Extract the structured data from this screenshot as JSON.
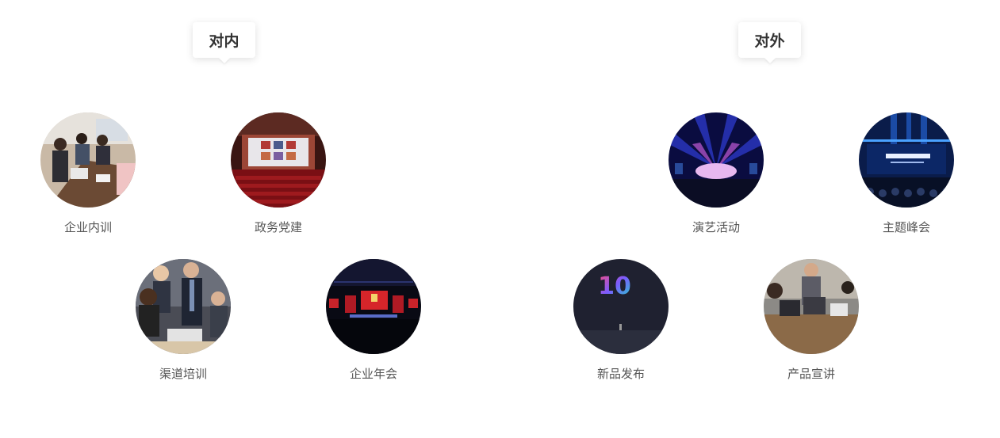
{
  "groups": {
    "internal": {
      "title": "对内"
    },
    "external": {
      "title": "对外"
    }
  },
  "items": {
    "training": {
      "label": "企业内训"
    },
    "party": {
      "label": "政务党建"
    },
    "channel": {
      "label": "渠道培训"
    },
    "annual": {
      "label": "企业年会"
    },
    "performance": {
      "label": "演艺活动"
    },
    "summit": {
      "label": "主题峰会"
    },
    "launch": {
      "label": "新品发布"
    },
    "promo": {
      "label": "产品宣讲"
    }
  },
  "graphic_text": {
    "launch_number": "10"
  }
}
